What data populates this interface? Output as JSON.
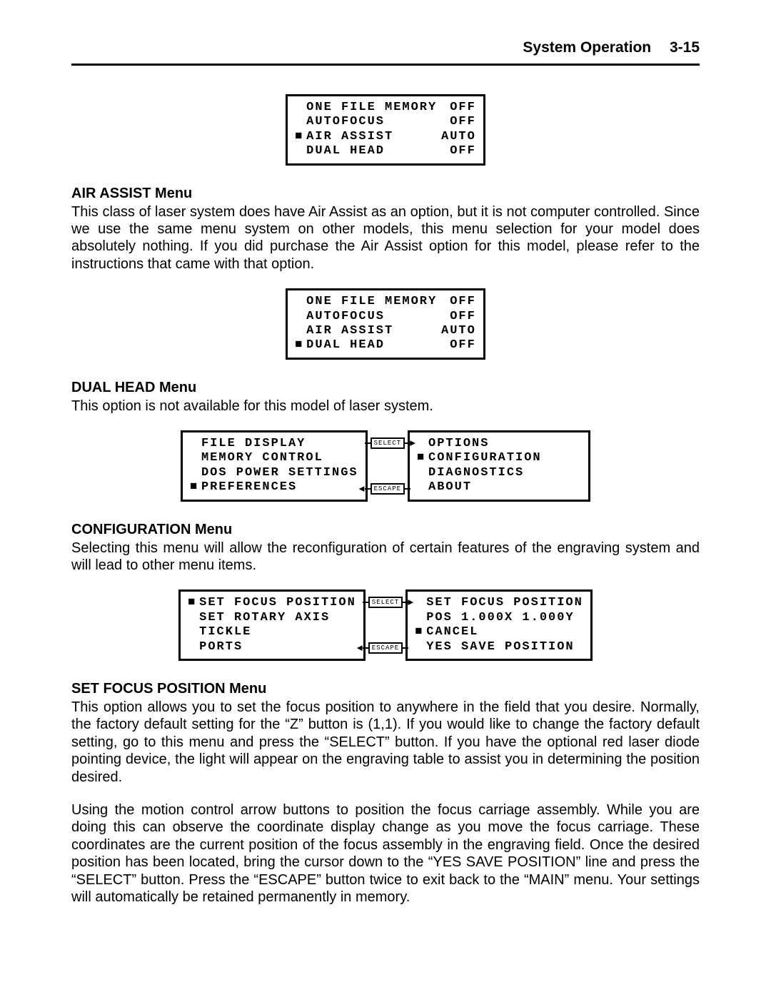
{
  "header": {
    "title": "System Operation",
    "page": "3-15"
  },
  "lcd_air_assist": {
    "rows": [
      {
        "marker": "",
        "label": "ONE FILE MEMORY",
        "value": "OFF"
      },
      {
        "marker": "",
        "label": "AUTOFOCUS",
        "value": "OFF"
      },
      {
        "marker": "■",
        "label": "AIR ASSIST",
        "value": "AUTO"
      },
      {
        "marker": "",
        "label": "DUAL HEAD",
        "value": "OFF"
      }
    ]
  },
  "section_air_assist": {
    "heading": "AIR ASSIST Menu",
    "body": "This class of laser system does have Air Assist as an option, but it is not computer controlled. Since we use the same menu system on other models, this menu selection for your model does absolutely nothing.  If you did purchase the Air Assist option for this model, please refer to the instructions that came with that option."
  },
  "lcd_dual_head": {
    "rows": [
      {
        "marker": "",
        "label": "ONE FILE MEMORY",
        "value": "OFF"
      },
      {
        "marker": "",
        "label": "AUTOFOCUS",
        "value": "OFF"
      },
      {
        "marker": "",
        "label": "AIR ASSIST",
        "value": "AUTO"
      },
      {
        "marker": "■",
        "label": "DUAL HEAD",
        "value": "OFF"
      }
    ]
  },
  "section_dual_head": {
    "heading": "DUAL HEAD Menu",
    "body": "This option is not available for this model of laser system."
  },
  "lcd_config_left": {
    "rows": [
      {
        "marker": "",
        "label": "FILE DISPLAY"
      },
      {
        "marker": "",
        "label": "MEMORY CONTROL"
      },
      {
        "marker": "",
        "label": "DOS POWER SETTINGS"
      },
      {
        "marker": "■",
        "label": "PREFERENCES"
      }
    ]
  },
  "lcd_config_right": {
    "rows": [
      {
        "marker": "",
        "label": "OPTIONS"
      },
      {
        "marker": "■",
        "label": "CONFIGURATION"
      },
      {
        "marker": "",
        "label": "DIAGNOSTICS"
      },
      {
        "marker": "",
        "label": "ABOUT"
      }
    ]
  },
  "btn_select": "SELECT",
  "btn_escape": "ESCAPE",
  "section_config": {
    "heading": "CONFIGURATION Menu",
    "body": "Selecting this menu will allow the reconfiguration of certain features of the engraving system and will lead to other menu items."
  },
  "lcd_focus_left": {
    "rows": [
      {
        "marker": "■",
        "label": "SET FOCUS POSITION"
      },
      {
        "marker": "",
        "label": "SET ROTARY AXIS"
      },
      {
        "marker": "",
        "label": "TICKLE"
      },
      {
        "marker": "",
        "label": "PORTS"
      }
    ]
  },
  "lcd_focus_right": {
    "rows": [
      {
        "marker": "",
        "label": "SET FOCUS POSITION"
      },
      {
        "marker": "",
        "label": "POS  1.000X 1.000Y"
      },
      {
        "marker": "■",
        "label": "CANCEL"
      },
      {
        "marker": "",
        "label": "YES SAVE POSITION"
      }
    ]
  },
  "section_focus": {
    "heading": "SET FOCUS POSITION Menu",
    "body1": "This option allows you to set the focus position to anywhere in the field that you desire. Normally, the factory default setting for the “Z” button is (1,1).  If you would like to change the factory default setting, go to this menu and press the “SELECT” button.  If you have the optional red laser diode pointing device, the light will appear on the engraving table to assist you in determining the position desired.",
    "body2": "Using the motion control arrow buttons to position the focus carriage assembly.  While you are doing this can observe the coordinate display change as you move the focus carriage.  These coordinates are the current position of the focus assembly in the engraving field.  Once the desired position has been located, bring the cursor down to the “YES SAVE POSITION” line and press the “SELECT” button.  Press the “ESCAPE” button twice to exit back to the “MAIN” menu. Your settings will automatically be retained permanently in memory."
  }
}
